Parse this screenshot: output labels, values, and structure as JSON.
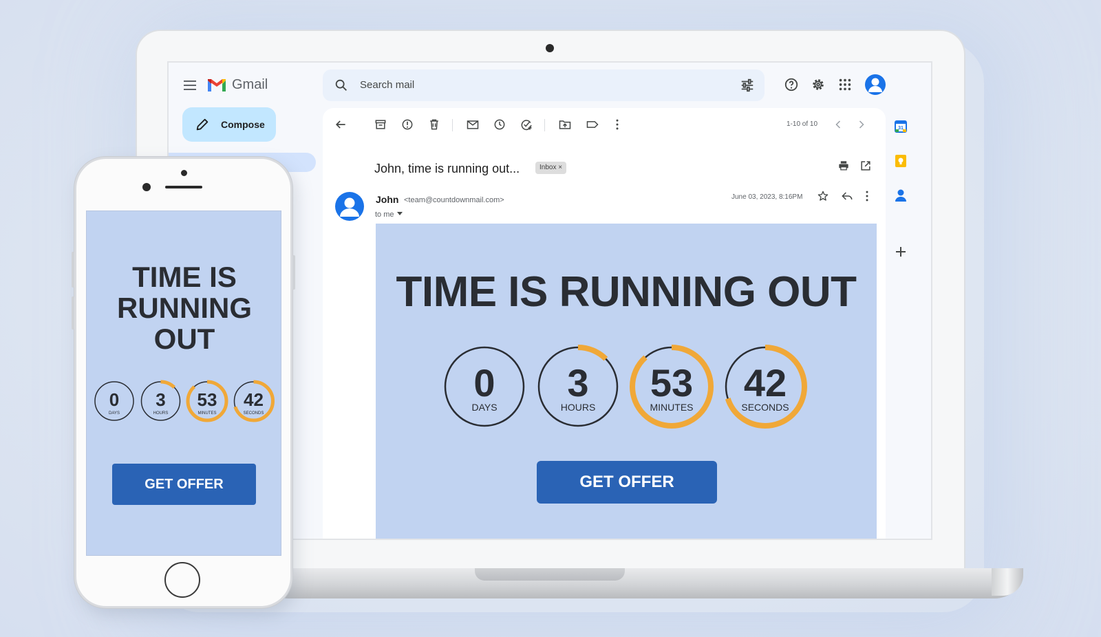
{
  "gmail": {
    "app_name": "Gmail",
    "search": {
      "placeholder": "Search mail"
    },
    "compose_label": "Compose",
    "pager": "1-10 of 10",
    "message": {
      "subject": "John, time is running out...",
      "label": "Inbox",
      "label_close": "×",
      "sender_name": "John",
      "sender_email": "<team@countdownmail.com>",
      "recipient": "to me",
      "date": "June 03, 2023, 8:16PM"
    }
  },
  "email": {
    "headline": "TIME IS RUNNING OUT",
    "headline_lines": [
      "TIME IS",
      "RUNNING",
      "OUT"
    ],
    "cta": "GET OFFER"
  },
  "countdown": [
    {
      "value": "0",
      "unit": "DAYS",
      "progress": 0
    },
    {
      "value": "3",
      "unit": "HOURS",
      "progress": 0.125
    },
    {
      "value": "53",
      "unit": "MINUTES",
      "progress": 0.883
    },
    {
      "value": "42",
      "unit": "SECONDS",
      "progress": 0.7
    }
  ],
  "colors": {
    "email_bg": "#c1d3f1",
    "accent_ring": "#f0a838",
    "cta_bg": "#2a63b5",
    "gmail_blue": "#1a73e8"
  },
  "icons": [
    "menu-icon",
    "gmail-logo",
    "search-icon",
    "tune-icon",
    "help-icon",
    "gear-icon",
    "apps-grid-icon",
    "account-icon",
    "pencil-icon",
    "back-arrow-icon",
    "archive-icon",
    "report-icon",
    "trash-icon",
    "mail-icon",
    "clock-icon",
    "task-icon",
    "move-to-icon",
    "label-icon",
    "more-vert-icon",
    "chevron-left-icon",
    "chevron-right-icon",
    "print-icon",
    "open-external-icon",
    "star-icon",
    "reply-icon",
    "calendar-icon",
    "keep-icon",
    "contacts-icon",
    "plus-icon"
  ]
}
